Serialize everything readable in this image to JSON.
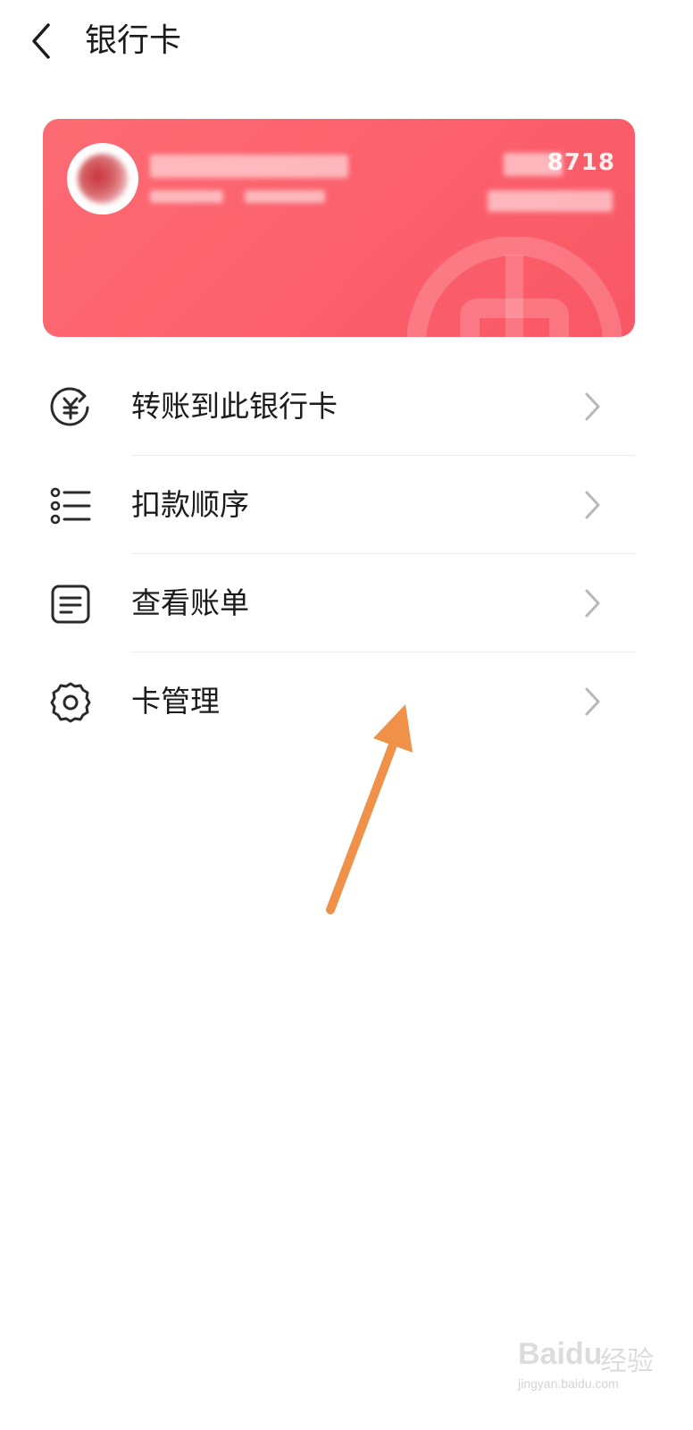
{
  "header": {
    "back_icon": "chevron-left-icon",
    "title": "银行卡"
  },
  "card": {
    "background_color": "#fb616c",
    "number_suffix": "8718"
  },
  "menu": {
    "items": [
      {
        "label": "转账到此银行卡",
        "icon": "yuan-transfer-icon"
      },
      {
        "label": "扣款顺序",
        "icon": "list-icon"
      },
      {
        "label": "查看账单",
        "icon": "bill-icon"
      },
      {
        "label": "卡管理",
        "icon": "gear-icon"
      }
    ],
    "chevron_icon": "chevron-right-icon"
  },
  "annotation": {
    "arrow_color": "#f0914a"
  },
  "watermark": {
    "brand": "Baidu",
    "brand_cn": "经验",
    "url": "jingyan.baidu.com"
  }
}
